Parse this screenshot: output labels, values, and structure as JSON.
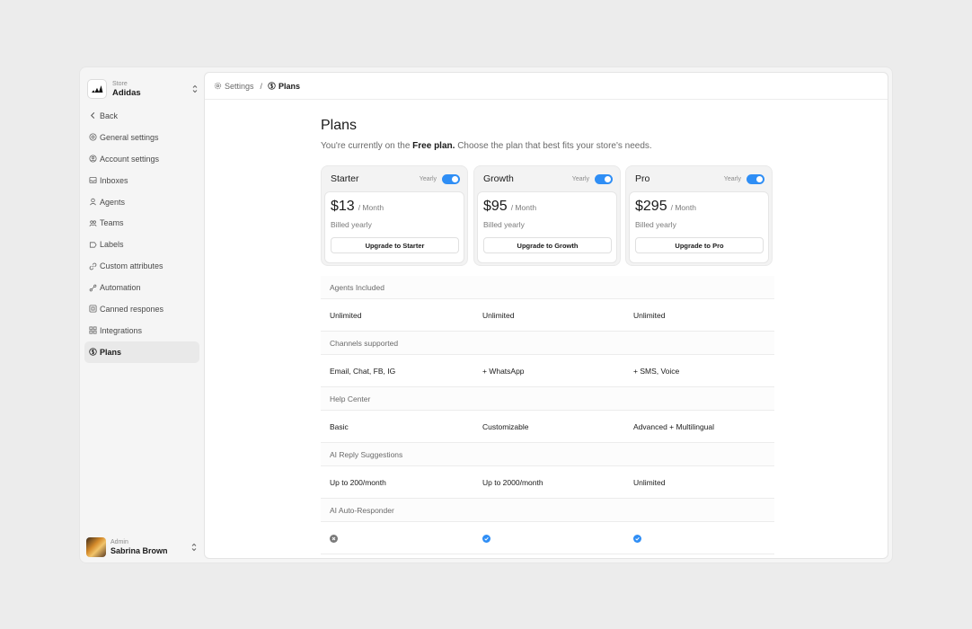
{
  "sidebar": {
    "store_label": "Store",
    "store_name": "Adidas",
    "back_label": "Back",
    "items": [
      {
        "label": "General settings",
        "icon": "settings-icon"
      },
      {
        "label": "Account settings",
        "icon": "account-icon"
      },
      {
        "label": "Inboxes",
        "icon": "inbox-icon"
      },
      {
        "label": "Agents",
        "icon": "user-icon"
      },
      {
        "label": "Teams",
        "icon": "team-icon"
      },
      {
        "label": "Labels",
        "icon": "tag-icon"
      },
      {
        "label": "Custom attributes",
        "icon": "link-icon"
      },
      {
        "label": "Automation",
        "icon": "automation-icon"
      },
      {
        "label": "Canned respones",
        "icon": "canned-icon"
      },
      {
        "label": "Integrations",
        "icon": "grid-icon"
      },
      {
        "label": "Plans",
        "icon": "dollar-icon",
        "active": true
      }
    ],
    "user_role": "Admin",
    "user_name": "Sabrina Brown"
  },
  "breadcrumb": {
    "parent": "Settings",
    "separator": "/",
    "current": "Plans"
  },
  "page": {
    "title": "Plans",
    "subtitle_prefix": "You're currently on the ",
    "subtitle_plan": "Free plan.",
    "subtitle_suffix": " Choose the plan that best fits your store's needs."
  },
  "plans": [
    {
      "name": "Starter",
      "yearly": "Yearly",
      "price": "$13",
      "per": "/ Month",
      "billed": "Billed yearly",
      "button": "Upgrade to Starter",
      "toggle_on": true
    },
    {
      "name": "Growth",
      "yearly": "Yearly",
      "price": "$95",
      "per": "/ Month",
      "billed": "Billed yearly",
      "button": "Upgrade to Growth",
      "toggle_on": true
    },
    {
      "name": "Pro",
      "yearly": "Yearly",
      "price": "$295",
      "per": "/ Month",
      "billed": "Billed yearly",
      "button": "Upgrade to Pro",
      "toggle_on": true
    }
  ],
  "features": [
    {
      "heading": "Agents Included",
      "values": [
        "Unlimited",
        "Unlimited",
        "Unlimited"
      ]
    },
    {
      "heading": "Channels supported",
      "values": [
        "Email, Chat, FB, IG",
        "+ WhatsApp",
        "+ SMS, Voice"
      ]
    },
    {
      "heading": "Help Center",
      "values": [
        "Basic",
        "Customizable",
        "Advanced + Multilingual"
      ]
    },
    {
      "heading": "AI Reply Suggestions",
      "values": [
        "Up to 200/month",
        "Up to 2000/month",
        "Unlimited"
      ]
    },
    {
      "heading": "AI Auto-Responder",
      "icons": [
        "cross-circle-icon",
        "check-circle-icon",
        "check-circle-icon"
      ]
    }
  ],
  "colors": {
    "accent": "#2f8ef5",
    "page_bg": "#ececec",
    "panel_bg": "#ffffff"
  }
}
